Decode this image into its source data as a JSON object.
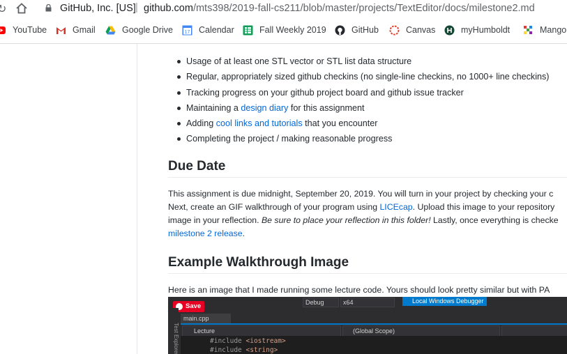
{
  "address_bar": {
    "site_identity": "GitHub, Inc. [US]",
    "separator": "|",
    "url_domain": "github.com",
    "url_path": "/mts398/2019-fall-cs211/blob/master/projects/TextEditor/docs/milestone2.md"
  },
  "bookmarks": [
    {
      "label": "YouTube",
      "icon": "youtube-icon"
    },
    {
      "label": "Gmail",
      "icon": "gmail-icon"
    },
    {
      "label": "Google Drive",
      "icon": "google-drive-icon"
    },
    {
      "label": "Calendar",
      "icon": "calendar-icon"
    },
    {
      "label": "Fall Weekly 2019",
      "icon": "sheets-icon"
    },
    {
      "label": "GitHub",
      "icon": "github-icon"
    },
    {
      "label": "Canvas",
      "icon": "canvas-icon"
    },
    {
      "label": "myHumboldt",
      "icon": "humboldt-icon"
    },
    {
      "label": "Mango",
      "icon": "mango-icon"
    }
  ],
  "colors": {
    "link": "#0366d6",
    "text": "#24292e",
    "pinterest": "#e60023",
    "vs_accent": "#007acc"
  },
  "requirements": {
    "item0": "Usage of at least one STL vector or STL list data structure",
    "item1": "Regular, appropriately sized github checkins (no single-line checkins, no 1000+ line checkins)",
    "item2": "Tracking progress on your github project board and github issue tracker",
    "item3_pre": "Maintaining a ",
    "item3_link": "design diary",
    "item3_post": " for this assignment",
    "item4_pre": "Adding ",
    "item4_link": "cool links and tutorials",
    "item4_post": " that you encounter",
    "item5": "Completing the project / making reasonable progress"
  },
  "due_date": {
    "heading": "Due Date",
    "line1": "This assignment is due midnight, September 20, 2019. You will turn in your project by checking your c",
    "line2_pre": "Next, create an GIF walkthrough of your program using ",
    "line2_link": "LICEcap",
    "line2_post": ". Upload this image to your repository",
    "line3_pre": "image in your reflection. ",
    "line3_em": "Be sure to place your reflection in this folder!",
    "line3_post": " Lastly, once everything is checke",
    "line4_link": "milestone 2 release",
    "line4_post": "."
  },
  "walkthrough": {
    "heading": "Example Walkthrough Image",
    "line1": "Here is an image that I made running some lecture code. Yours should look pretty similar but with PA"
  },
  "vs_image": {
    "save_button": "Save",
    "config": "Debug",
    "platform": "x64",
    "debugger": "Local Windows Debugger",
    "side_panel": "Test Explorer",
    "tab": "main.cpp",
    "scope_project": "Lecture",
    "scope_global": "(Global Scope)",
    "code_line1_directive": "#include",
    "code_line1_file": "<iostream>",
    "code_line2_directive": "#include",
    "code_line2_file": "<string>"
  }
}
